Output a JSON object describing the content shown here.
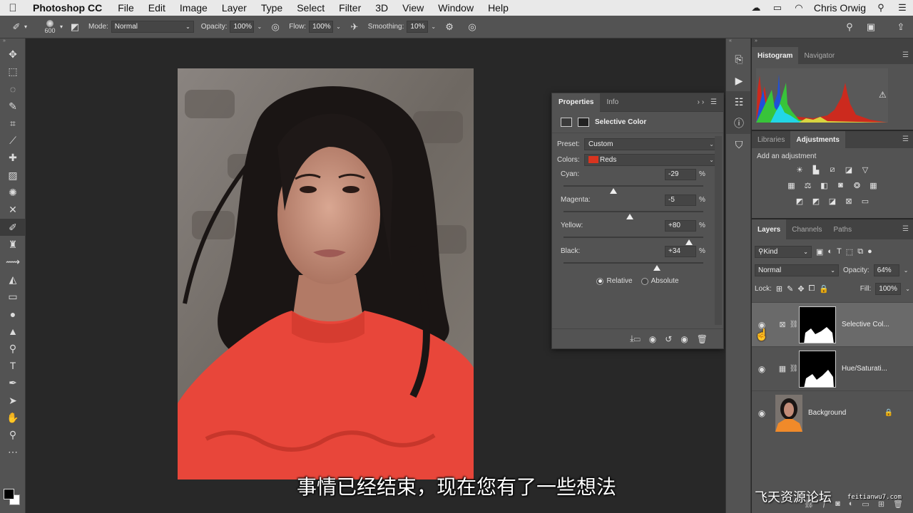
{
  "menubar": {
    "app_name": "Photoshop CC",
    "items": [
      "File",
      "Edit",
      "Image",
      "Layer",
      "Type",
      "Select",
      "Filter",
      "3D",
      "View",
      "Window",
      "Help"
    ],
    "user": "Chris Orwig"
  },
  "options_bar": {
    "brush_size": "600",
    "mode_label": "Mode:",
    "mode_value": "Normal",
    "opacity_label": "Opacity:",
    "opacity_value": "100%",
    "flow_label": "Flow:",
    "flow_value": "100%",
    "smoothing_label": "Smoothing:",
    "smoothing_value": "10%"
  },
  "tools": [
    {
      "name": "move-tool",
      "glyph": "✥"
    },
    {
      "name": "marquee-tool",
      "glyph": "⬚"
    },
    {
      "name": "lasso-tool",
      "glyph": "◌"
    },
    {
      "name": "quick-select-tool",
      "glyph": "✎"
    },
    {
      "name": "crop-tool",
      "glyph": "⌗"
    },
    {
      "name": "eyedropper-tool",
      "glyph": "⟋"
    },
    {
      "name": "spot-heal-tool",
      "glyph": "✚"
    },
    {
      "name": "heal-tool",
      "glyph": "▨"
    },
    {
      "name": "patch-tool",
      "glyph": "✺"
    },
    {
      "name": "content-move-tool",
      "glyph": "✕"
    },
    {
      "name": "brush-tool",
      "glyph": "✐",
      "active": true
    },
    {
      "name": "clone-stamp-tool",
      "glyph": "♜"
    },
    {
      "name": "history-brush-tool",
      "glyph": "⟿"
    },
    {
      "name": "eraser-tool",
      "glyph": "◭"
    },
    {
      "name": "gradient-tool",
      "glyph": "▭"
    },
    {
      "name": "blur-tool",
      "glyph": "●"
    },
    {
      "name": "sharpen-tool",
      "glyph": "▲"
    },
    {
      "name": "dodge-tool",
      "glyph": "⚲"
    },
    {
      "name": "type-tool",
      "glyph": "T"
    },
    {
      "name": "pen-tool",
      "glyph": "✒"
    },
    {
      "name": "path-select-tool",
      "glyph": "➤"
    },
    {
      "name": "hand-tool",
      "glyph": "✋"
    },
    {
      "name": "zoom-tool",
      "glyph": "⚲"
    },
    {
      "name": "more-tools",
      "glyph": "⋯"
    }
  ],
  "properties": {
    "tabs": [
      "Properties",
      "Info"
    ],
    "title": "Selective Color",
    "preset_label": "Preset:",
    "preset_value": "Custom",
    "colors_label": "Colors:",
    "colors_value": "Reds",
    "sliders": [
      {
        "label": "Cyan:",
        "value": "-29",
        "level": -29
      },
      {
        "label": "Magenta:",
        "value": "-5",
        "level": -5
      },
      {
        "label": "Yellow:",
        "value": "+80",
        "level": 80
      },
      {
        "label": "Black:",
        "value": "+34",
        "level": 34
      }
    ],
    "percent": "%",
    "relative_label": "Relative",
    "absolute_label": "Absolute",
    "method": "Relative"
  },
  "histogram_panel": {
    "tabs": [
      "Histogram",
      "Navigator"
    ]
  },
  "adjustments_panel": {
    "tabs": [
      "Libraries",
      "Adjustments"
    ],
    "heading": "Add an adjustment"
  },
  "layers_panel": {
    "tabs": [
      "Layers",
      "Channels",
      "Paths"
    ],
    "kind_value": "Kind",
    "blend_value": "Normal",
    "opacity_label": "Opacity:",
    "opacity_value": "64%",
    "lock_label": "Lock:",
    "fill_label": "Fill:",
    "fill_value": "100%",
    "layers": [
      {
        "name": "Selective Col...",
        "selected": true
      },
      {
        "name": "Hue/Saturati...",
        "selected": false
      },
      {
        "name": "Background",
        "selected": false
      }
    ]
  },
  "subtitle": "事情已经结束，现在您有了一些想法",
  "watermark": "飞天资源论坛",
  "watermark_url": "feitianwu7.com"
}
